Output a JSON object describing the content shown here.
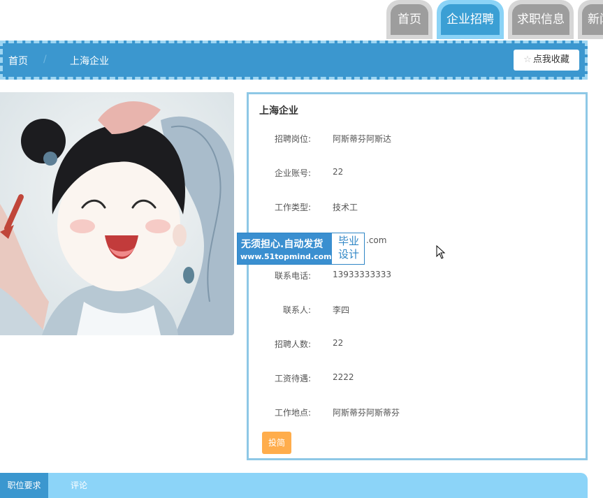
{
  "nav": {
    "tabs": [
      {
        "label": "首页",
        "active": false
      },
      {
        "label": "企业招聘",
        "active": true
      },
      {
        "label": "求职信息",
        "active": false
      },
      {
        "label": "新闻",
        "active": false
      }
    ]
  },
  "breadcrumb": {
    "home": "首页",
    "separator": "/",
    "current": "上海企业"
  },
  "favorite": {
    "label": "点我收藏",
    "icon": "star-outline-icon"
  },
  "detail": {
    "title": "上海企业",
    "fields": [
      {
        "label": "招聘岗位:",
        "value": "阿斯蒂芬阿斯达"
      },
      {
        "label": "企业账号:",
        "value": "22"
      },
      {
        "label": "工作类型:",
        "value": "技术工"
      },
      {
        "label": "",
        "value": ".com"
      },
      {
        "label": "联系电话:",
        "value": "13933333333"
      },
      {
        "label": "联系人:",
        "value": "李四"
      },
      {
        "label": "招聘人数:",
        "value": "22"
      },
      {
        "label": "工资待遇:",
        "value": "2222"
      },
      {
        "label": "工作地点:",
        "value": "阿斯蒂芬阿斯蒂芬"
      }
    ],
    "apply_label": "投简"
  },
  "watermark": {
    "line1": "无须担心.自动发货",
    "line2": "www.51topmind.com",
    "right_top": "毕业",
    "right_bottom": "设计"
  },
  "bottom_tabs": [
    {
      "label": "职位要求",
      "active": true
    },
    {
      "label": "评论",
      "active": false
    }
  ],
  "colors": {
    "primary": "#3b97cf",
    "nav_active_outer": "#8bd3f6",
    "nav_inactive": "#9d9d9d",
    "apply": "#ffad4c",
    "bottom_bar": "#8cd4f8"
  }
}
